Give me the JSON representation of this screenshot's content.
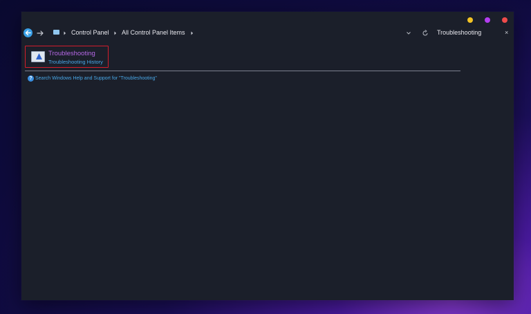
{
  "window": {
    "controls": [
      "minimize",
      "maximize",
      "close"
    ]
  },
  "address_bar": {
    "breadcrumbs": [
      {
        "label": "Control Panel"
      },
      {
        "label": "All Control Panel Items"
      }
    ],
    "search_value": "Troubleshooting",
    "clear_label": "×",
    "icons": {
      "back": "back-arrow-icon",
      "forward": "forward-arrow-icon",
      "location": "control-panel-icon",
      "dropdown": "chevron-down-icon",
      "refresh": "refresh-icon"
    }
  },
  "results": [
    {
      "title": "Troubleshooting",
      "subtitle": "Troubleshooting History",
      "icon": "troubleshooting-icon"
    }
  ],
  "help_link": {
    "icon_glyph": "?",
    "text": "Search Windows Help and Support for \"Troubleshooting\""
  },
  "colors": {
    "window_bg": "#1b1f2a",
    "link_purple": "#b668e6",
    "link_blue": "#49a8e8",
    "highlight_border": "#d41d2c",
    "dot_yellow": "#f3c324",
    "dot_purple": "#b33df0",
    "dot_red": "#ef4b4b"
  }
}
